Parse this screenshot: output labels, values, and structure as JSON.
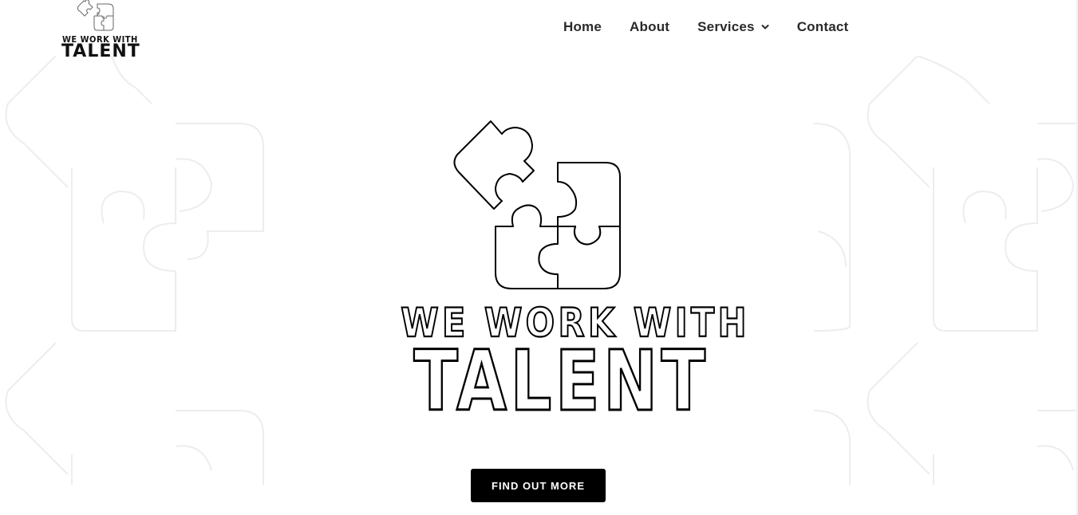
{
  "logo": {
    "line1": "WE WORK WITH",
    "line2": "TALENT",
    "icon": "puzzle-icon"
  },
  "nav": {
    "items": [
      {
        "label": "Home"
      },
      {
        "label": "About"
      },
      {
        "label": "Services",
        "icon": "chevron-down-icon"
      },
      {
        "label": "Contact"
      }
    ]
  },
  "hero": {
    "line1": "WE WORK WITH",
    "line2": "TALENT",
    "icon": "puzzle-icon",
    "cta_label": "FIND OUT MORE"
  },
  "colors": {
    "background": "#ffffff",
    "text": "#2a2a2a",
    "button": "#000000",
    "pattern": "#ececec"
  }
}
